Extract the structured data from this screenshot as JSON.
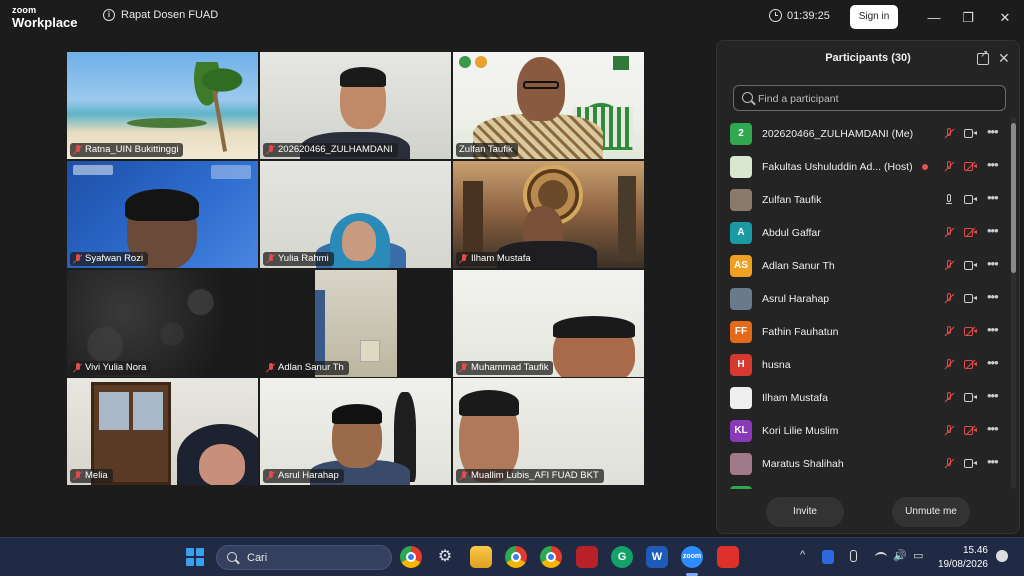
{
  "app": {
    "logo_line1": "zoom",
    "logo_line2": "Workplace",
    "meeting_title": "Rapat Dosen FUAD",
    "timer": "01:39:25",
    "sign_in_label": "Sign in",
    "minimize": "—",
    "maximize": "❐",
    "close": "✕"
  },
  "tiles": [
    {
      "name": "Ratna_UIN Bukittinggi",
      "muted": true
    },
    {
      "name": "202620466_ZULHAMDANI",
      "muted": true
    },
    {
      "name": "Zulfan Taufik",
      "muted": false,
      "active": true
    },
    {
      "name": "Syafwan Rozi",
      "muted": true
    },
    {
      "name": "Yulia Rahmi",
      "muted": true
    },
    {
      "name": "Ilham Mustafa",
      "muted": true
    },
    {
      "name": "Vivi Yulia Nora",
      "muted": true
    },
    {
      "name": "Adlan Sanur Th",
      "muted": true
    },
    {
      "name": "Muhammad Taufik",
      "muted": true
    },
    {
      "name": "Melia",
      "muted": true
    },
    {
      "name": "Asrul Harahap",
      "muted": true
    },
    {
      "name": "Muallim Lubis_AFI FUAD BKT",
      "muted": true
    }
  ],
  "participants": {
    "title": "Participants (30)",
    "search_placeholder": "Find a participant",
    "invite_label": "Invite",
    "unmute_me_label": "Unmute me",
    "list": [
      {
        "name": "202620466_ZULHAMDANI (Me)",
        "initials": "2",
        "color": "#2fa84f",
        "mic": "off",
        "cam": "on"
      },
      {
        "name": "Fakultas Ushuluddin Ad... (Host)",
        "initials": "",
        "color": "#d8e8d0",
        "mic": "off",
        "cam": "off",
        "recording": true
      },
      {
        "name": "Zulfan Taufik",
        "initials": "",
        "color": "#8a7a6a",
        "mic": "on",
        "cam": "on"
      },
      {
        "name": "Abdul Gaffar",
        "initials": "A",
        "color": "#1a9aa5",
        "mic": "off",
        "cam": "off"
      },
      {
        "name": "Adlan Sanur Th",
        "initials": "AS",
        "color": "#f0a020",
        "mic": "off",
        "cam": "on"
      },
      {
        "name": "Asrul Harahap",
        "initials": "",
        "color": "#6a7a8a",
        "mic": "off",
        "cam": "on"
      },
      {
        "name": "Fathin Fauhatun",
        "initials": "FF",
        "color": "#e46a1a",
        "mic": "off",
        "cam": "off"
      },
      {
        "name": "husna",
        "initials": "H",
        "color": "#d63a2e",
        "mic": "off",
        "cam": "off"
      },
      {
        "name": "Ilham Mustafa",
        "initials": "",
        "color": "#eeeeee",
        "mic": "off",
        "cam": "on"
      },
      {
        "name": "Kori Lilie Muslim",
        "initials": "KL",
        "color": "#8a3ab8",
        "mic": "off",
        "cam": "off"
      },
      {
        "name": "Maratus Shalihah",
        "initials": "",
        "color": "#a07a8a",
        "mic": "off",
        "cam": "on"
      }
    ]
  },
  "taskbar": {
    "search_text": "Cari",
    "time": "15.46",
    "date": "19/08/2026",
    "apps": [
      "Chrome",
      "Settings",
      "File Explorer",
      "Chrome",
      "Chrome",
      "Mendeley",
      "Grammarly",
      "Word",
      "Zoom",
      "Acrobat"
    ],
    "word_glyph": "W",
    "zoom_glyph": "zoom",
    "grammarly_glyph": "G",
    "tray_chevron": "^",
    "tray_speaker": "🔊",
    "tray_battery": "▭"
  }
}
